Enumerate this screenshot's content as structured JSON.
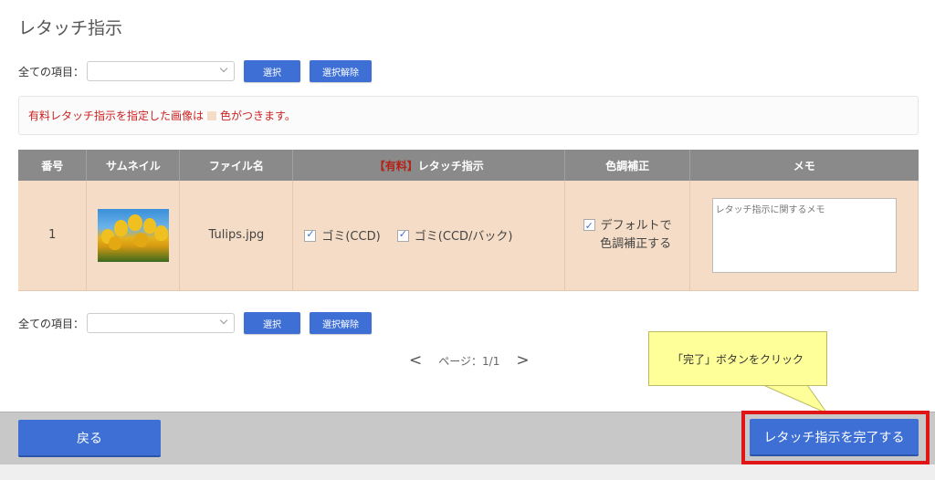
{
  "page": {
    "title": "レタッチ指示"
  },
  "bulk_top": {
    "label": "全ての項目：",
    "select_value": "",
    "select_button": "選択",
    "clear_button": "選択解除"
  },
  "notice": {
    "text_before": "有料レタッチ指示を指定した画像は",
    "text_after": "色がつきます。",
    "swatch_color": "#f5dcc6"
  },
  "table": {
    "headers": {
      "number": "番号",
      "thumbnail": "サムネイル",
      "filename": "ファイル名",
      "retouch_paid_tag": "【有料】",
      "retouch": "レタッチ指示",
      "color_correction": "色調補正",
      "memo": "メモ"
    },
    "rows": [
      {
        "number": "1",
        "thumbnail_icon": "tulips-image",
        "filename": "Tulips.jpg",
        "retouch_options": [
          "ゴミ(CCD)",
          "ゴミ(CCD/バック)"
        ],
        "color_correction_line1": "デフォルトで",
        "color_correction_line2": "色調補正する",
        "memo_placeholder": "レタッチ指示に関するメモ"
      }
    ]
  },
  "bulk_bottom": {
    "label": "全ての項目：",
    "select_value": "",
    "select_button": "選択",
    "clear_button": "選択解除"
  },
  "pager": {
    "prev": "<",
    "text": "ページ：1/1",
    "next": ">"
  },
  "callout": {
    "text": "「完了」ボタンをクリック"
  },
  "footer": {
    "back_button": "戻る",
    "complete_button": "レタッチ指示を完了する"
  },
  "colors": {
    "accent": "#3d6fd4",
    "row_paid_bg": "#f5dcc6",
    "header_bg": "#8a8a8a",
    "highlight": "#e01515",
    "notice_text": "#cc2222",
    "callout_bg": "#ffff99"
  }
}
